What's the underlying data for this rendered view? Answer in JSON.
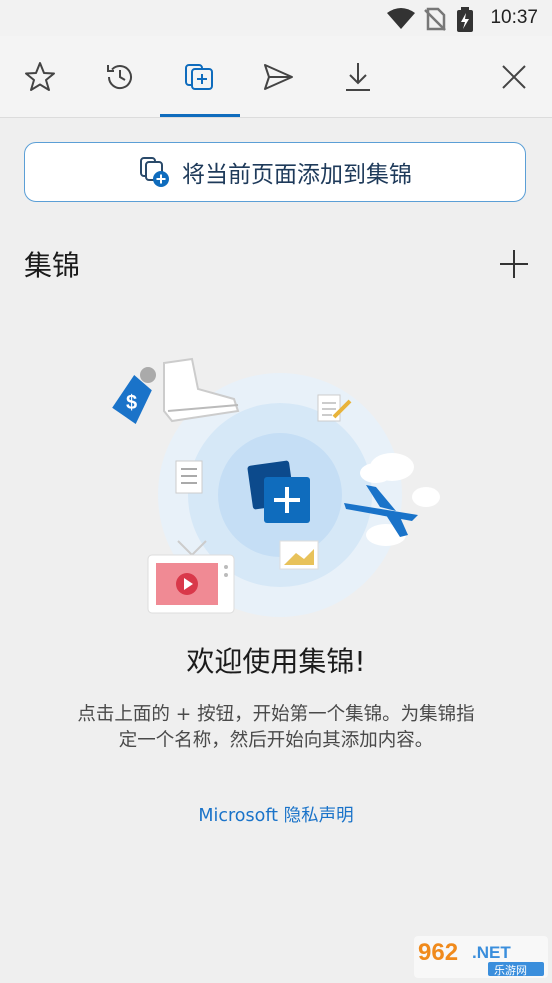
{
  "status_bar": {
    "time": "10:37",
    "icons": [
      "wifi-icon",
      "no-sim-icon",
      "battery-charging-icon"
    ]
  },
  "toolbar": {
    "tabs": [
      {
        "name": "favorites",
        "icon": "star-icon"
      },
      {
        "name": "history",
        "icon": "history-icon"
      },
      {
        "name": "collections",
        "icon": "collections-icon",
        "active": true
      },
      {
        "name": "share",
        "icon": "send-icon"
      },
      {
        "name": "downloads",
        "icon": "download-icon"
      }
    ],
    "close_icon": "close-icon",
    "accent": "#0f6cbd"
  },
  "add_page": {
    "label": "将当前页面添加到集锦"
  },
  "collections": {
    "title": "集锦"
  },
  "empty_state": {
    "welcome": "欢迎使用集锦!",
    "description": "点击上面的 + 按钮，开始第一个集锦。为集锦指定一个名称，然后开始向其添加内容。",
    "privacy_link": "Microsoft 隐私声明"
  },
  "watermark": {
    "brand": "962",
    "suffix": ".NET",
    "caption": "乐游网"
  }
}
